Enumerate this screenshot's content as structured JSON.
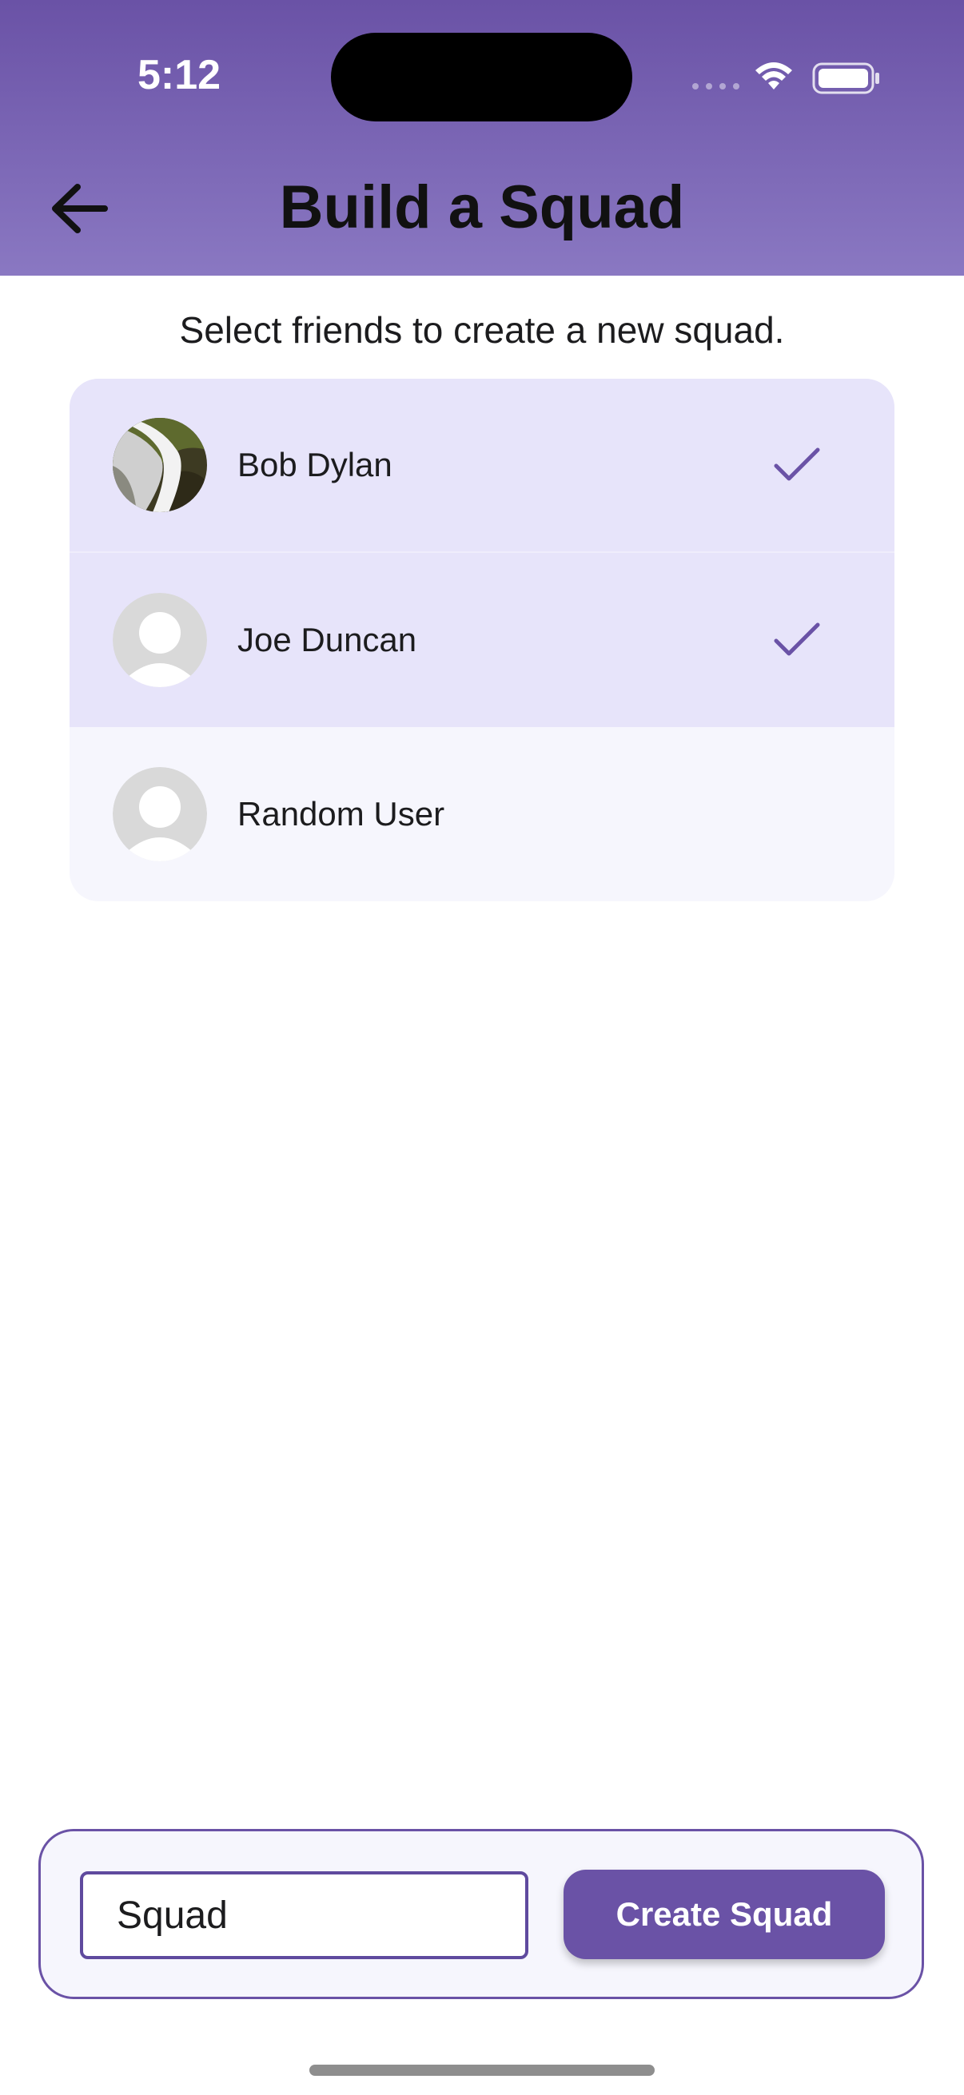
{
  "status_bar": {
    "time": "5:12",
    "icons": [
      "signal-dots-icon",
      "wifi-icon",
      "battery-icon"
    ]
  },
  "header": {
    "title": "Build a Squad",
    "back_icon": "arrow-left-icon"
  },
  "subtitle": "Select friends to create a new squad.",
  "friends": [
    {
      "name": "Bob Dylan",
      "avatar": "waterfall-photo",
      "selected": true
    },
    {
      "name": "Joe Duncan",
      "avatar": "default-avatar-icon",
      "selected": true
    },
    {
      "name": "Random User",
      "avatar": "default-avatar-icon",
      "selected": false
    }
  ],
  "squad_form": {
    "name_value": "Squad",
    "create_label": "Create Squad"
  },
  "colors": {
    "accent": "#6a52a6",
    "header_top": "#6a52a6",
    "header_bottom": "#8a78c2",
    "selected_row": "#e7e4fa",
    "unselected_row": "#f6f6fd"
  }
}
